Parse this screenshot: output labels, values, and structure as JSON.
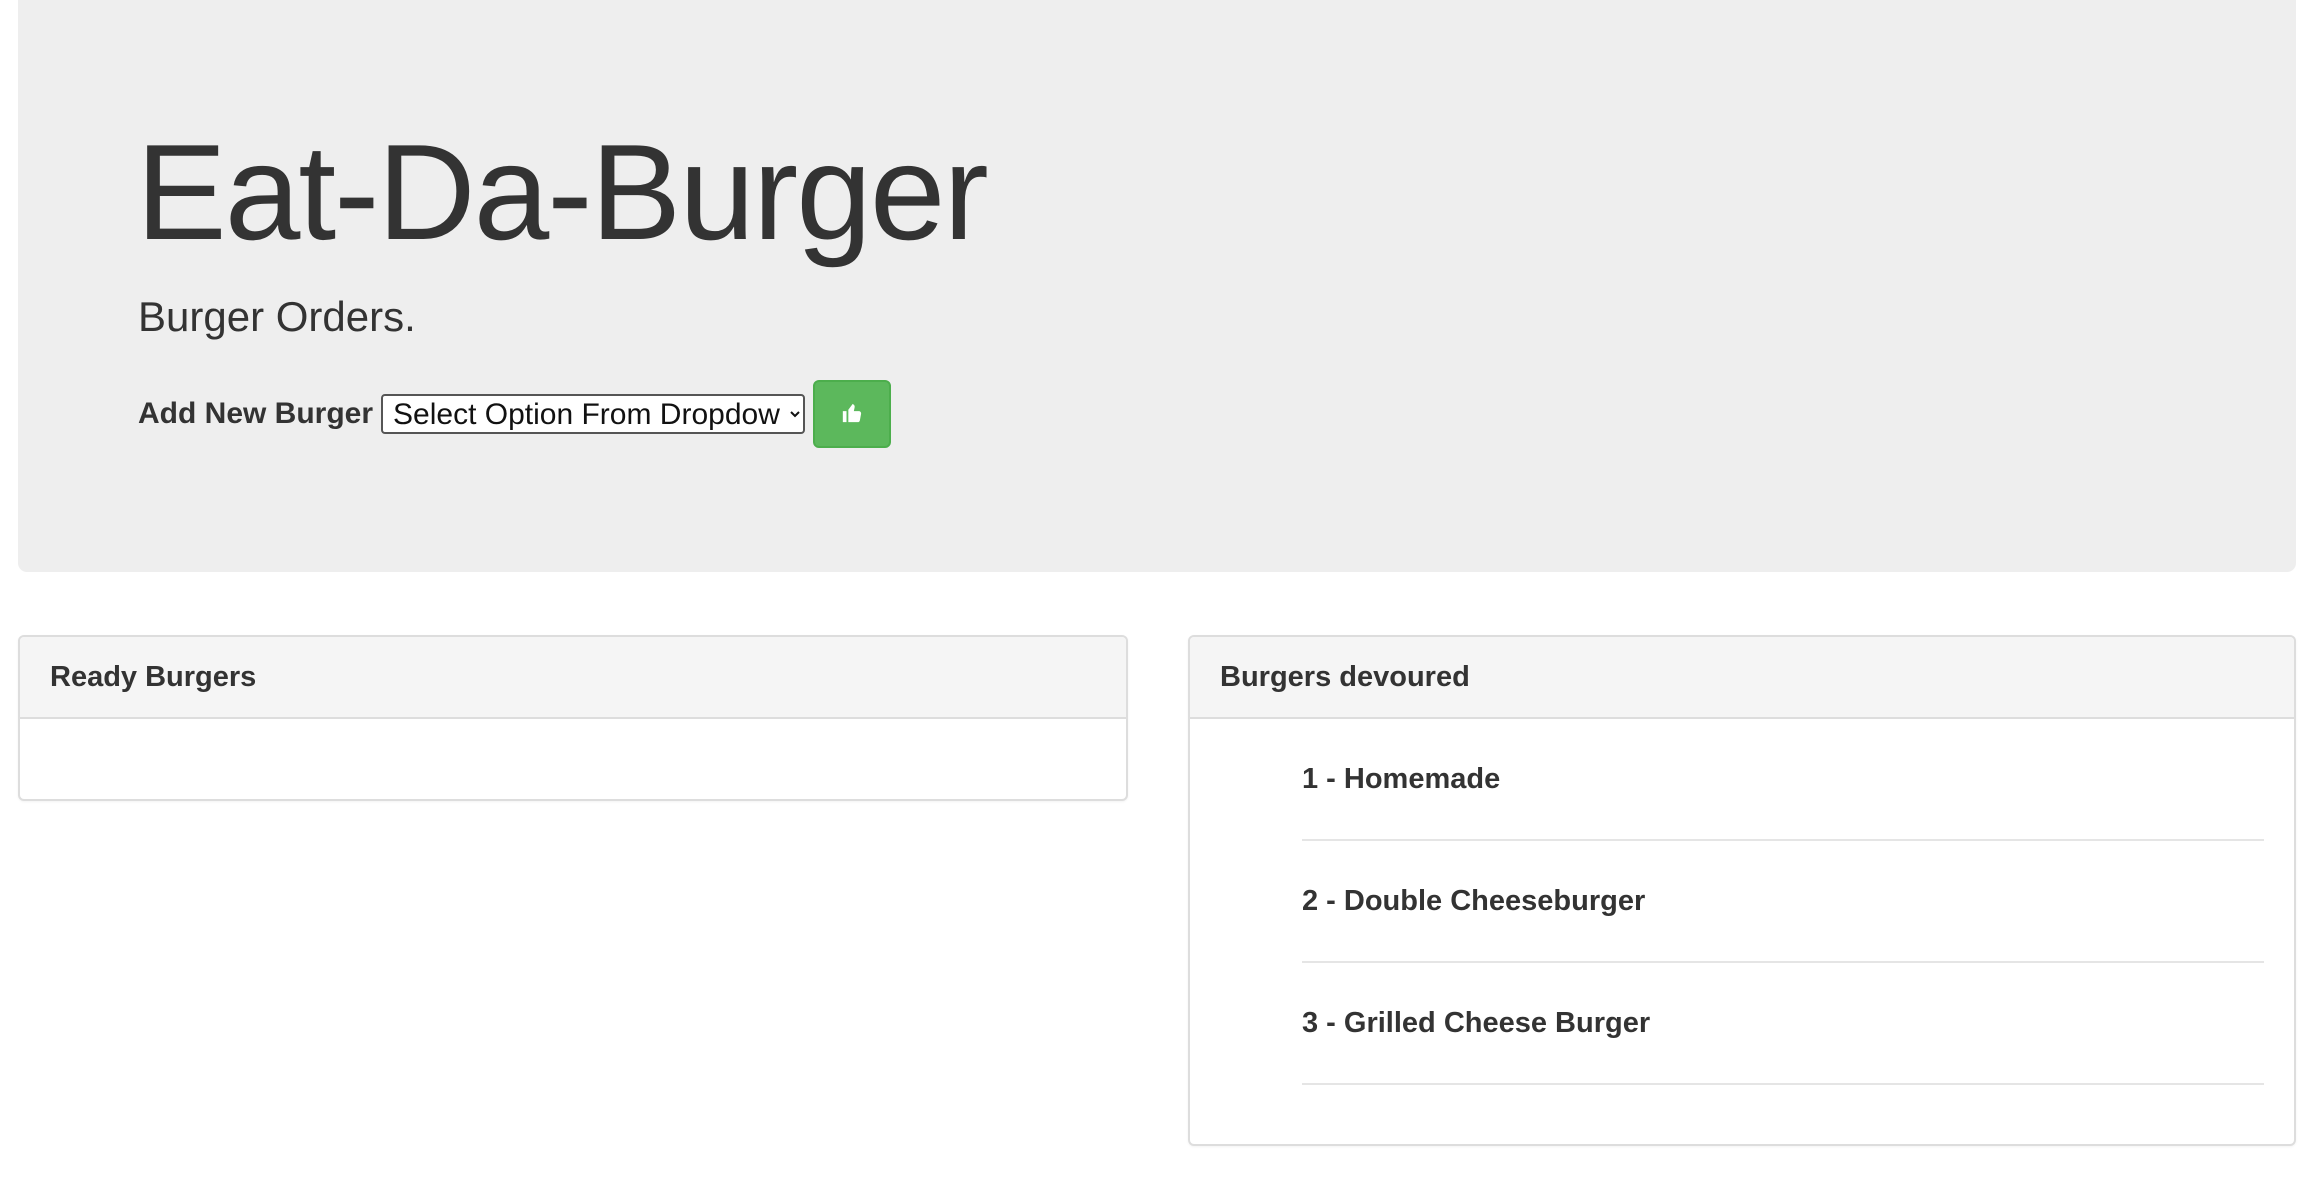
{
  "header": {
    "title": "Eat-Da-Burger",
    "subtitle": "Burger Orders."
  },
  "add_form": {
    "label": "Add New Burger",
    "select_value": "Select Option From Dropdown",
    "submit_icon": "thumbs-up-icon",
    "submit_color": "#5cb85c"
  },
  "ready_panel": {
    "title": "Ready Burgers",
    "items": []
  },
  "devoured_panel": {
    "title": "Burgers devoured",
    "items": [
      {
        "label": "1 - Homemade"
      },
      {
        "label": "2 - Double Cheeseburger"
      },
      {
        "label": "3 - Grilled Cheese Burger"
      }
    ]
  },
  "colors": {
    "jumbotron_bg": "#eeeeee",
    "text": "#333333",
    "panel_heading_bg": "#f5f5f5",
    "border": "#dddddd"
  }
}
